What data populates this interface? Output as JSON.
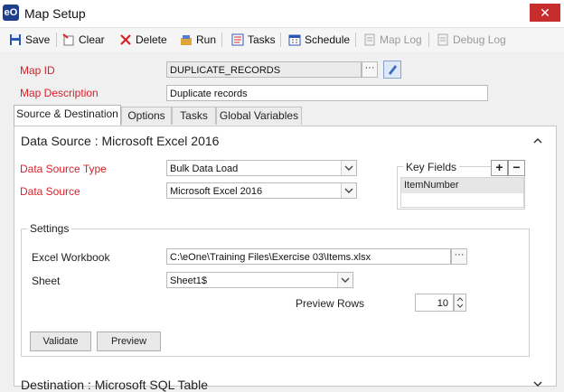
{
  "window": {
    "title": "Map Setup",
    "app_icon": "eone-logo",
    "close_label": "✕"
  },
  "toolbar": {
    "save": "Save",
    "clear": "Clear",
    "delete": "Delete",
    "run": "Run",
    "tasks": "Tasks",
    "schedule": "Schedule",
    "map_log": "Map Log",
    "debug_log": "Debug Log"
  },
  "map": {
    "id_label": "Map ID",
    "id_value": "DUPLICATE_RECORDS",
    "desc_label": "Map Description",
    "desc_value": "Duplicate records"
  },
  "tabs": [
    "Source & Destination",
    "Options",
    "Tasks",
    "Global Variables"
  ],
  "source": {
    "section_title": "Data Source : Microsoft Excel 2016",
    "type_label": "Data Source Type",
    "type_value": "Bulk Data Load",
    "source_label": "Data Source",
    "source_value": "Microsoft Excel 2016"
  },
  "key_fields": {
    "title": "Key Fields",
    "add": "+",
    "remove": "−",
    "items": [
      "ItemNumber"
    ]
  },
  "settings": {
    "title": "Settings",
    "workbook_label": "Excel Workbook",
    "workbook_value": "C:\\eOne\\Training Files\\Exercise 03\\Items.xlsx",
    "sheet_label": "Sheet",
    "sheet_value": "Sheet1$",
    "preview_rows_label": "Preview Rows",
    "preview_rows_value": "10",
    "validate_button": "Validate",
    "preview_button": "Preview"
  },
  "destination": {
    "section_title": "Destination : Microsoft SQL Table"
  },
  "colors": {
    "required_label": "#d9202a",
    "close": "#c62d2d",
    "accent": "#1f3f8a"
  }
}
